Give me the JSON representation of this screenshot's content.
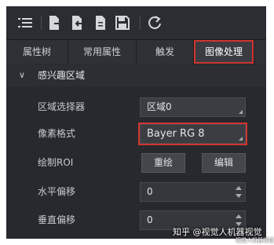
{
  "toolbar": {
    "icons": [
      "list-icon",
      "export-file-icon",
      "import-file-icon",
      "document-icon",
      "save-icon",
      "refresh-icon"
    ]
  },
  "tabs": [
    {
      "label": "属性树",
      "active": false
    },
    {
      "label": "常用属性",
      "active": false
    },
    {
      "label": "触发",
      "active": false
    },
    {
      "label": "图像处理",
      "active": true
    }
  ],
  "group": {
    "label": "感兴趣区域"
  },
  "rows": {
    "region_selector": {
      "label": "区域选择器",
      "value": "区域0"
    },
    "pixel_format": {
      "label": "像素格式",
      "value": "Bayer RG 8"
    },
    "draw_roi": {
      "label": "绘制ROI",
      "redraw": "重绘",
      "edit": "编辑"
    },
    "h_offset": {
      "label": "水平偏移",
      "value": "0"
    },
    "v_offset": {
      "label": "垂直偏移",
      "value": "0"
    }
  },
  "watermark": {
    "text": "知乎 @视觉人机器视觉",
    "sub": "视觉人机器视觉"
  },
  "colors": {
    "highlight": "#d0352f",
    "panel": "#27292e"
  }
}
